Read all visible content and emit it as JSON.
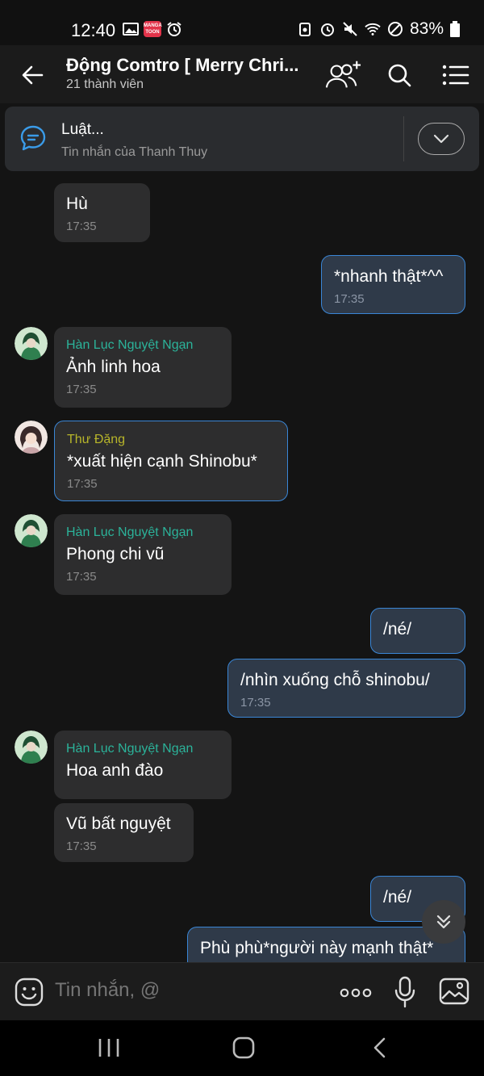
{
  "status_bar": {
    "time": "12:40",
    "battery": "83%",
    "manga_badge": "MANGA TOON"
  },
  "header": {
    "title": "Động Comtro [ Merry Chri...",
    "subtitle": "21 thành viên"
  },
  "pinned": {
    "title": "Luật...",
    "subtitle": "Tin nhắn của Thanh Thuy"
  },
  "messages": [
    {
      "id": "m1",
      "dir": "in",
      "text": "Hù",
      "time": "17:35"
    },
    {
      "id": "m2",
      "dir": "out",
      "text": "*nhanh thật*^^",
      "time": "17:35"
    },
    {
      "id": "m3",
      "dir": "in",
      "sender": "Hàn Lục Nguyệt Ngạn",
      "text": "Ảnh linh hoa",
      "time": "17:35"
    },
    {
      "id": "m4",
      "dir": "in",
      "sender": "Thư Đặng",
      "text": "*xuất hiện cạnh Shinobu*",
      "time": "17:35"
    },
    {
      "id": "m5",
      "dir": "in",
      "sender": "Hàn Lục Nguyệt Ngạn",
      "text": "Phong chi vũ",
      "time": "17:35"
    },
    {
      "id": "m6",
      "dir": "out",
      "text": "/né/"
    },
    {
      "id": "m7",
      "dir": "out",
      "text": "/nhìn xuống chỗ shinobu/",
      "time": "17:35"
    },
    {
      "id": "m8",
      "dir": "in",
      "sender": "Hàn Lục Nguyệt Ngạn",
      "text": "Hoa anh đào"
    },
    {
      "id": "m9",
      "dir": "in",
      "text": "Vũ bất nguyệt",
      "time": "17:35"
    },
    {
      "id": "m10",
      "dir": "out",
      "text": "/né/"
    },
    {
      "id": "m11",
      "dir": "out",
      "text": "Phù phù*người này mạnh thật*"
    }
  ],
  "composer": {
    "placeholder": "Tin nhắn, @"
  },
  "colors": {
    "sender_green": "#2bb39a",
    "sender_yellow": "#b7b52a",
    "accent_blue": "#3a86d6",
    "bubble_in": "#2d2d2e",
    "bubble_out": "#2f3a49"
  }
}
